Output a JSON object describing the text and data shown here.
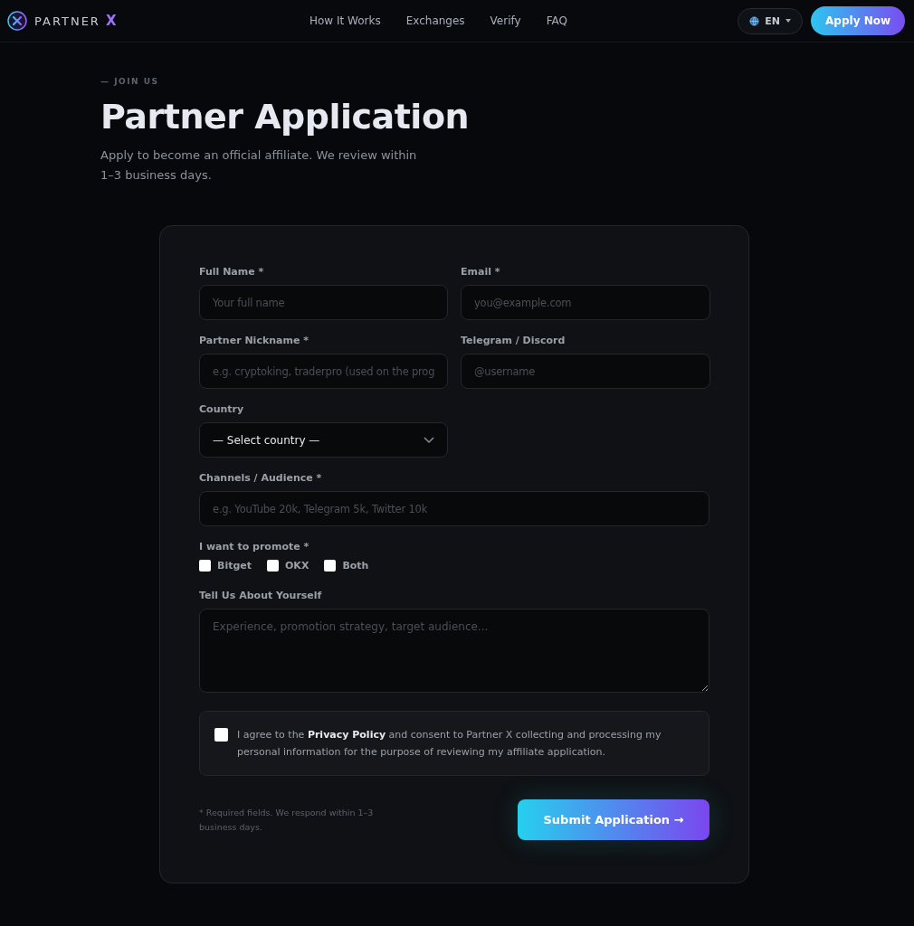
{
  "header": {
    "brand": "PARTNER",
    "brand_mark": "X",
    "nav": [
      {
        "label": "How It Works"
      },
      {
        "label": "Exchanges"
      },
      {
        "label": "Verify"
      },
      {
        "label": "FAQ"
      }
    ],
    "language": "EN",
    "cta": "Apply Now"
  },
  "hero": {
    "eyebrow": "— JOIN US",
    "title": "Partner Application",
    "subtitle": "Apply to become an official affiliate. We review within 1–3 business days."
  },
  "form": {
    "rows": [
      [
        {
          "kind": "text",
          "label": "Full Name *",
          "placeholder": "Your full name"
        },
        {
          "kind": "text",
          "label": "Email *",
          "placeholder": "you@example.com"
        }
      ],
      [
        {
          "kind": "text",
          "label": "Partner Nickname *",
          "placeholder": "e.g. cryptoking, traderpro (used on the prog"
        },
        {
          "kind": "text",
          "label": "Telegram / Discord",
          "placeholder": "@username"
        }
      ],
      [
        {
          "kind": "select",
          "label": "Country",
          "value": "— Select country —"
        }
      ],
      [
        {
          "kind": "wide",
          "label": "Channels / Audience *",
          "placeholder": "e.g. YouTube 20k, Telegram 5k, Twitter 10k"
        }
      ]
    ],
    "promote": {
      "label": "I want to promote *",
      "options": [
        {
          "label": "Bitget",
          "checked": false
        },
        {
          "label": "OKX",
          "checked": false
        },
        {
          "label": "Both",
          "checked": false
        }
      ]
    },
    "about": {
      "label": "Tell Us About Yourself",
      "placeholder": "Experience, promotion strategy, target audience..."
    },
    "consent": {
      "checked": false,
      "text": "I agree to the **Privacy Policy** and consent to Partner X collecting and processing my personal information for the purpose of reviewing my affiliate application."
    },
    "note": "* Required fields. We respond within 1–3 business days.",
    "submit": "Submit Application →"
  }
}
